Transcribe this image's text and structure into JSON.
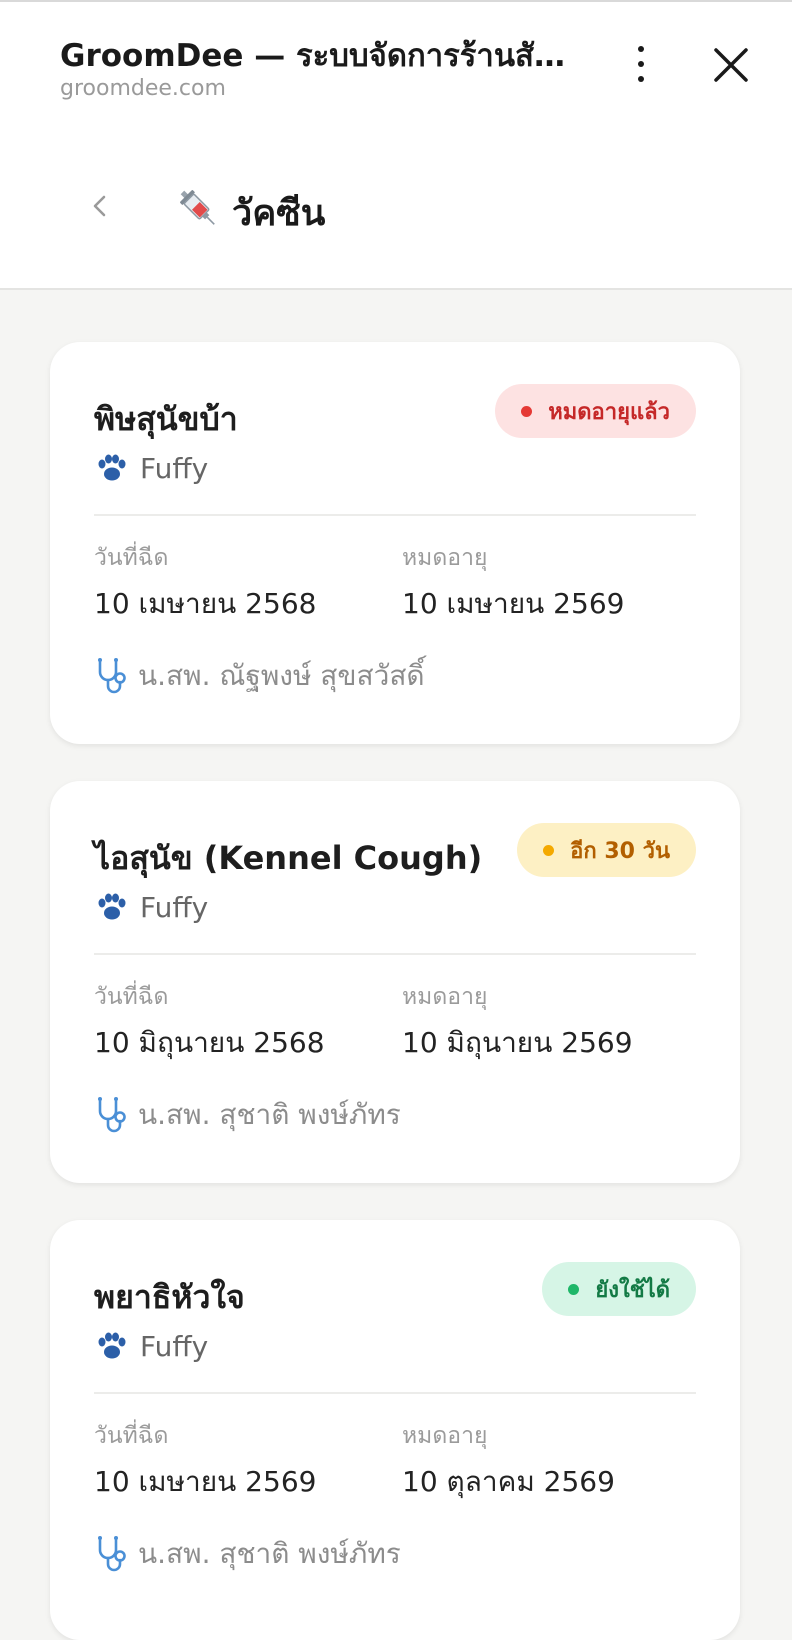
{
  "browser": {
    "title": "GroomDee — ระบบจัดการร้านสัตว์เลี้ยง",
    "url": "groomdee.com",
    "menu_icon": "more-vertical-icon",
    "close_icon": "close-icon"
  },
  "header": {
    "back_icon": "chevron-left-icon",
    "title_icon": "syringe-icon",
    "title": "วัคซีน"
  },
  "labels": {
    "date_given": "วันที่ฉีด",
    "expiry": "หมดอายุ"
  },
  "colors": {
    "expired": "#e53935",
    "soon": "#f4a900",
    "valid": "#1fb769"
  },
  "vaccines": [
    {
      "name": "พิษสุนัขบ้า",
      "status": "หมดอายุแล้ว",
      "status_type": "expired",
      "pet": "Fuffy",
      "date_given": "10 เมษายน 2568",
      "expiry": "10 เมษายน 2569",
      "vet": "น.สพ. ณัฐพงษ์ สุขสวัสดิ์"
    },
    {
      "name": "ไอสุนัข (Kennel Cough)",
      "status": "อีก 30 วัน",
      "status_type": "soon",
      "pet": "Fuffy",
      "date_given": "10 มิถุนายน 2568",
      "expiry": "10 มิถุนายน 2569",
      "vet": "น.สพ. สุชาติ พงษ์ภัทร"
    },
    {
      "name": "พยาธิหัวใจ",
      "status": "ยังใช้ได้",
      "status_type": "valid",
      "pet": "Fuffy",
      "date_given": "10 เมษายน 2569",
      "expiry": "10 ตุลาคม 2569",
      "vet": "น.สพ. สุชาติ พงษ์ภัทร"
    }
  ]
}
